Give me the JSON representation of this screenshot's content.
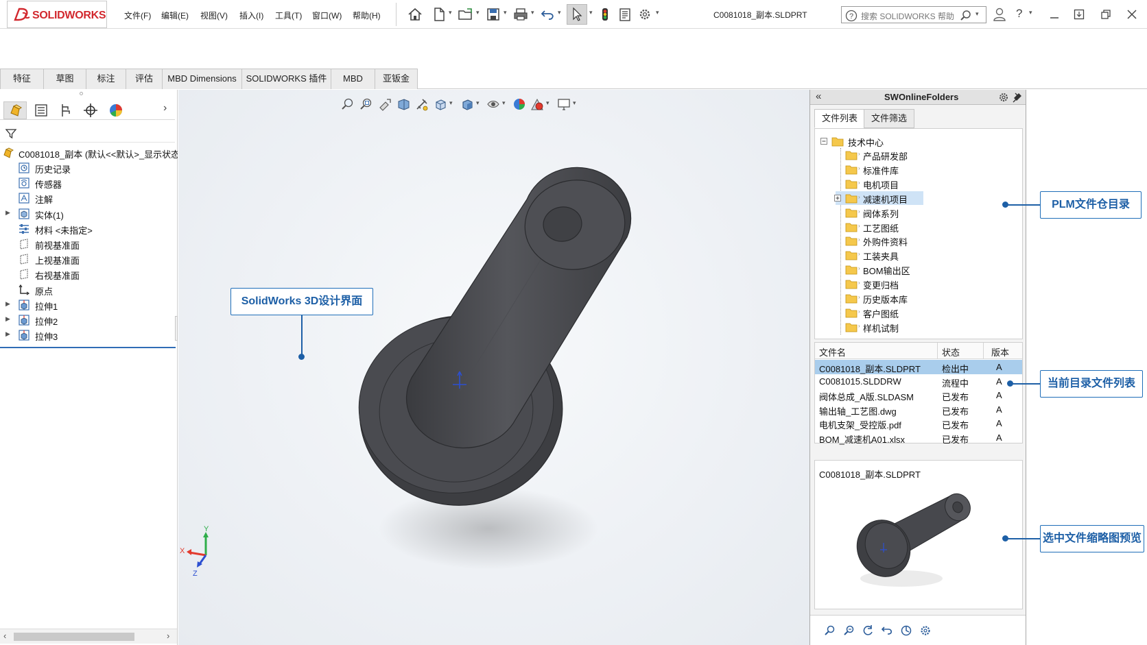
{
  "app": {
    "brand_bold": "SOLIDWORKS",
    "doc_title": "C0081018_副本.SLDPRT"
  },
  "menu": [
    "文件(F)",
    "编辑(E)",
    "视图(V)",
    "插入(I)",
    "工具(T)",
    "窗口(W)",
    "帮助(H)"
  ],
  "search": {
    "placeholder": "搜索 SOLIDWORKS 帮助"
  },
  "command_tabs": [
    "特征",
    "草图",
    "标注",
    "评估",
    "MBD Dimensions",
    "SOLIDWORKS 插件",
    "MBD",
    "亚钣金"
  ],
  "feature_tree": {
    "root": "C0081018_副本 (默认<<默认>_显示状态",
    "items": [
      {
        "label": "历史记录",
        "icon": "history-icon"
      },
      {
        "label": "传感器",
        "icon": "sensor-icon"
      },
      {
        "label": "注解",
        "icon": "annotation-icon"
      },
      {
        "label": "实体(1)",
        "icon": "solid-body-icon",
        "expandable": true
      },
      {
        "label": "材料 <未指定>",
        "icon": "material-icon"
      },
      {
        "label": "前视基准面",
        "icon": "plane-icon"
      },
      {
        "label": "上视基准面",
        "icon": "plane-icon"
      },
      {
        "label": "右视基准面",
        "icon": "plane-icon"
      },
      {
        "label": "原点",
        "icon": "origin-icon"
      },
      {
        "label": "拉伸1",
        "icon": "extrude-icon",
        "expandable": true
      },
      {
        "label": "拉伸2",
        "icon": "extrude-icon",
        "expandable": true
      },
      {
        "label": "拉伸3",
        "icon": "extrude-icon",
        "expandable": true
      }
    ]
  },
  "triad": {
    "x": "X",
    "y": "Y",
    "z": "Z"
  },
  "right_panel": {
    "title": "SWOnlineFolders",
    "tabs": [
      "文件列表",
      "文件筛选"
    ],
    "tree_root": "技术中心",
    "folders": [
      "产品研发部",
      "标准件库",
      "电机项目",
      "减速机项目",
      "阀体系列",
      "工艺图纸",
      "外购件资料",
      "工装夹具",
      "BOM输出区",
      "变更归档",
      "历史版本库",
      "客户图纸",
      "样机试制"
    ],
    "selected_folder": "减速机项目",
    "table_headers": [
      "文件名",
      "状态",
      "版本"
    ],
    "files": [
      {
        "name": "C0081018_副本.SLDPRT",
        "status": "检出中",
        "version": "A"
      },
      {
        "name": "C0081015.SLDDRW",
        "status": "流程中",
        "version": "A"
      },
      {
        "name": "阀体总成_A版.SLDASM",
        "status": "已发布",
        "version": "A"
      },
      {
        "name": "输出轴_工艺图.dwg",
        "status": "已发布",
        "version": "A"
      },
      {
        "name": "电机支架_受控版.pdf",
        "status": "已发布",
        "version": "A"
      },
      {
        "name": "BOM_减速机A01.xlsx",
        "status": "已发布",
        "version": "A"
      }
    ],
    "preview_filename": "C0081018_副本.SLDPRT"
  },
  "callouts": {
    "design": "SolidWorks 3D设计界面",
    "plm": "PLM文件仓目录",
    "list": "当前目录文件列表",
    "preview": "选中文件缩略图预览"
  },
  "colors": {
    "accent": "#1d5fa6",
    "brand": "#d2282e",
    "row_selected": "#a9cdec"
  }
}
